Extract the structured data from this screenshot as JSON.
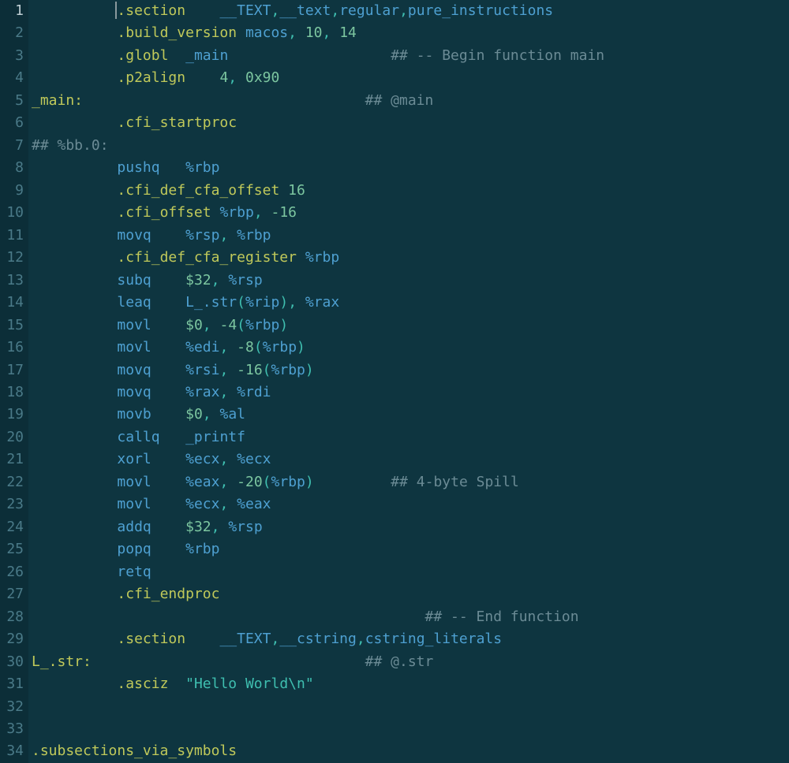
{
  "lines": [
    {
      "n": 1,
      "current": true,
      "tokens": [
        {
          "t": "    ",
          "c": "tok-plain"
        },
        {
          "t": "|",
          "c": "cursor"
        },
        {
          "t": ".section",
          "c": "tok-dir"
        },
        {
          "t": "    ",
          "c": "tok-plain"
        },
        {
          "t": "__TEXT",
          "c": "tok-id"
        },
        {
          "t": ",",
          "c": "tok-punct"
        },
        {
          "t": "__text",
          "c": "tok-id"
        },
        {
          "t": ",",
          "c": "tok-punct"
        },
        {
          "t": "regular",
          "c": "tok-id"
        },
        {
          "t": ",",
          "c": "tok-punct"
        },
        {
          "t": "pure_instructions",
          "c": "tok-id"
        }
      ]
    },
    {
      "n": 2,
      "tokens": [
        {
          "t": "    ",
          "c": "tok-plain"
        },
        {
          "t": ".build_version",
          "c": "tok-dir"
        },
        {
          "t": " ",
          "c": "tok-plain"
        },
        {
          "t": "macos",
          "c": "tok-id"
        },
        {
          "t": ", ",
          "c": "tok-punct"
        },
        {
          "t": "10",
          "c": "tok-num"
        },
        {
          "t": ", ",
          "c": "tok-punct"
        },
        {
          "t": "14",
          "c": "tok-num"
        }
      ]
    },
    {
      "n": 3,
      "tokens": [
        {
          "t": "    ",
          "c": "tok-plain"
        },
        {
          "t": ".globl",
          "c": "tok-dir"
        },
        {
          "t": "  ",
          "c": "tok-plain"
        },
        {
          "t": "_main",
          "c": "tok-id"
        },
        {
          "t": "                   ",
          "c": "tok-plain"
        },
        {
          "t": "## -- Begin function main",
          "c": "tok-cmt"
        }
      ]
    },
    {
      "n": 4,
      "tokens": [
        {
          "t": "    ",
          "c": "tok-plain"
        },
        {
          "t": ".p2align",
          "c": "tok-dir"
        },
        {
          "t": "    ",
          "c": "tok-plain"
        },
        {
          "t": "4",
          "c": "tok-num"
        },
        {
          "t": ", ",
          "c": "tok-punct"
        },
        {
          "t": "0x90",
          "c": "tok-num"
        }
      ]
    },
    {
      "n": 5,
      "tokens": [
        {
          "t": "_main:",
          "c": "tok-label"
        },
        {
          "t": "                                 ",
          "c": "tok-plain"
        },
        {
          "t": "## @main",
          "c": "tok-cmt"
        }
      ]
    },
    {
      "n": 6,
      "tokens": [
        {
          "t": "    ",
          "c": "tok-plain"
        },
        {
          "t": ".cfi_startproc",
          "c": "tok-dir"
        }
      ]
    },
    {
      "n": 7,
      "tokens": [
        {
          "t": "## %bb.0:",
          "c": "tok-cmt"
        }
      ]
    },
    {
      "n": 8,
      "tokens": [
        {
          "t": "    ",
          "c": "tok-plain"
        },
        {
          "t": "pushq",
          "c": "tok-mnem"
        },
        {
          "t": "   ",
          "c": "tok-plain"
        },
        {
          "t": "%rbp",
          "c": "tok-reg"
        }
      ]
    },
    {
      "n": 9,
      "tokens": [
        {
          "t": "    ",
          "c": "tok-plain"
        },
        {
          "t": ".cfi_def_cfa_offset",
          "c": "tok-dir"
        },
        {
          "t": " ",
          "c": "tok-plain"
        },
        {
          "t": "16",
          "c": "tok-num"
        }
      ]
    },
    {
      "n": 10,
      "tokens": [
        {
          "t": "    ",
          "c": "tok-plain"
        },
        {
          "t": ".cfi_offset",
          "c": "tok-dir"
        },
        {
          "t": " ",
          "c": "tok-plain"
        },
        {
          "t": "%rbp",
          "c": "tok-reg"
        },
        {
          "t": ", ",
          "c": "tok-punct"
        },
        {
          "t": "-16",
          "c": "tok-num"
        }
      ]
    },
    {
      "n": 11,
      "tokens": [
        {
          "t": "    ",
          "c": "tok-plain"
        },
        {
          "t": "movq",
          "c": "tok-mnem"
        },
        {
          "t": "    ",
          "c": "tok-plain"
        },
        {
          "t": "%rsp",
          "c": "tok-reg"
        },
        {
          "t": ", ",
          "c": "tok-punct"
        },
        {
          "t": "%rbp",
          "c": "tok-reg"
        }
      ]
    },
    {
      "n": 12,
      "tokens": [
        {
          "t": "    ",
          "c": "tok-plain"
        },
        {
          "t": ".cfi_def_cfa_register",
          "c": "tok-dir"
        },
        {
          "t": " ",
          "c": "tok-plain"
        },
        {
          "t": "%rbp",
          "c": "tok-reg"
        }
      ]
    },
    {
      "n": 13,
      "tokens": [
        {
          "t": "    ",
          "c": "tok-plain"
        },
        {
          "t": "subq",
          "c": "tok-mnem"
        },
        {
          "t": "    ",
          "c": "tok-plain"
        },
        {
          "t": "$32",
          "c": "tok-num"
        },
        {
          "t": ", ",
          "c": "tok-punct"
        },
        {
          "t": "%rsp",
          "c": "tok-reg"
        }
      ]
    },
    {
      "n": 14,
      "tokens": [
        {
          "t": "    ",
          "c": "tok-plain"
        },
        {
          "t": "leaq",
          "c": "tok-mnem"
        },
        {
          "t": "    ",
          "c": "tok-plain"
        },
        {
          "t": "L_.str",
          "c": "tok-id"
        },
        {
          "t": "(",
          "c": "tok-punct"
        },
        {
          "t": "%rip",
          "c": "tok-reg"
        },
        {
          "t": ")",
          "c": "tok-punct"
        },
        {
          "t": ", ",
          "c": "tok-punct"
        },
        {
          "t": "%rax",
          "c": "tok-reg"
        }
      ]
    },
    {
      "n": 15,
      "tokens": [
        {
          "t": "    ",
          "c": "tok-plain"
        },
        {
          "t": "movl",
          "c": "tok-mnem"
        },
        {
          "t": "    ",
          "c": "tok-plain"
        },
        {
          "t": "$0",
          "c": "tok-num"
        },
        {
          "t": ", ",
          "c": "tok-punct"
        },
        {
          "t": "-4",
          "c": "tok-num"
        },
        {
          "t": "(",
          "c": "tok-punct"
        },
        {
          "t": "%rbp",
          "c": "tok-reg"
        },
        {
          "t": ")",
          "c": "tok-punct"
        }
      ]
    },
    {
      "n": 16,
      "tokens": [
        {
          "t": "    ",
          "c": "tok-plain"
        },
        {
          "t": "movl",
          "c": "tok-mnem"
        },
        {
          "t": "    ",
          "c": "tok-plain"
        },
        {
          "t": "%edi",
          "c": "tok-reg"
        },
        {
          "t": ", ",
          "c": "tok-punct"
        },
        {
          "t": "-8",
          "c": "tok-num"
        },
        {
          "t": "(",
          "c": "tok-punct"
        },
        {
          "t": "%rbp",
          "c": "tok-reg"
        },
        {
          "t": ")",
          "c": "tok-punct"
        }
      ]
    },
    {
      "n": 17,
      "tokens": [
        {
          "t": "    ",
          "c": "tok-plain"
        },
        {
          "t": "movq",
          "c": "tok-mnem"
        },
        {
          "t": "    ",
          "c": "tok-plain"
        },
        {
          "t": "%rsi",
          "c": "tok-reg"
        },
        {
          "t": ", ",
          "c": "tok-punct"
        },
        {
          "t": "-16",
          "c": "tok-num"
        },
        {
          "t": "(",
          "c": "tok-punct"
        },
        {
          "t": "%rbp",
          "c": "tok-reg"
        },
        {
          "t": ")",
          "c": "tok-punct"
        }
      ]
    },
    {
      "n": 18,
      "tokens": [
        {
          "t": "    ",
          "c": "tok-plain"
        },
        {
          "t": "movq",
          "c": "tok-mnem"
        },
        {
          "t": "    ",
          "c": "tok-plain"
        },
        {
          "t": "%rax",
          "c": "tok-reg"
        },
        {
          "t": ", ",
          "c": "tok-punct"
        },
        {
          "t": "%rdi",
          "c": "tok-reg"
        }
      ]
    },
    {
      "n": 19,
      "tokens": [
        {
          "t": "    ",
          "c": "tok-plain"
        },
        {
          "t": "movb",
          "c": "tok-mnem"
        },
        {
          "t": "    ",
          "c": "tok-plain"
        },
        {
          "t": "$0",
          "c": "tok-num"
        },
        {
          "t": ", ",
          "c": "tok-punct"
        },
        {
          "t": "%al",
          "c": "tok-reg"
        }
      ]
    },
    {
      "n": 20,
      "tokens": [
        {
          "t": "    ",
          "c": "tok-plain"
        },
        {
          "t": "callq",
          "c": "tok-mnem"
        },
        {
          "t": "   ",
          "c": "tok-plain"
        },
        {
          "t": "_printf",
          "c": "tok-id"
        }
      ]
    },
    {
      "n": 21,
      "tokens": [
        {
          "t": "    ",
          "c": "tok-plain"
        },
        {
          "t": "xorl",
          "c": "tok-mnem"
        },
        {
          "t": "    ",
          "c": "tok-plain"
        },
        {
          "t": "%ecx",
          "c": "tok-reg"
        },
        {
          "t": ", ",
          "c": "tok-punct"
        },
        {
          "t": "%ecx",
          "c": "tok-reg"
        }
      ]
    },
    {
      "n": 22,
      "tokens": [
        {
          "t": "    ",
          "c": "tok-plain"
        },
        {
          "t": "movl",
          "c": "tok-mnem"
        },
        {
          "t": "    ",
          "c": "tok-plain"
        },
        {
          "t": "%eax",
          "c": "tok-reg"
        },
        {
          "t": ", ",
          "c": "tok-punct"
        },
        {
          "t": "-20",
          "c": "tok-num"
        },
        {
          "t": "(",
          "c": "tok-punct"
        },
        {
          "t": "%rbp",
          "c": "tok-reg"
        },
        {
          "t": ")",
          "c": "tok-punct"
        },
        {
          "t": "         ",
          "c": "tok-plain"
        },
        {
          "t": "## 4-byte Spill",
          "c": "tok-cmt"
        }
      ]
    },
    {
      "n": 23,
      "tokens": [
        {
          "t": "    ",
          "c": "tok-plain"
        },
        {
          "t": "movl",
          "c": "tok-mnem"
        },
        {
          "t": "    ",
          "c": "tok-plain"
        },
        {
          "t": "%ecx",
          "c": "tok-reg"
        },
        {
          "t": ", ",
          "c": "tok-punct"
        },
        {
          "t": "%eax",
          "c": "tok-reg"
        }
      ]
    },
    {
      "n": 24,
      "tokens": [
        {
          "t": "    ",
          "c": "tok-plain"
        },
        {
          "t": "addq",
          "c": "tok-mnem"
        },
        {
          "t": "    ",
          "c": "tok-plain"
        },
        {
          "t": "$32",
          "c": "tok-num"
        },
        {
          "t": ", ",
          "c": "tok-punct"
        },
        {
          "t": "%rsp",
          "c": "tok-reg"
        }
      ]
    },
    {
      "n": 25,
      "tokens": [
        {
          "t": "    ",
          "c": "tok-plain"
        },
        {
          "t": "popq",
          "c": "tok-mnem"
        },
        {
          "t": "    ",
          "c": "tok-plain"
        },
        {
          "t": "%rbp",
          "c": "tok-reg"
        }
      ]
    },
    {
      "n": 26,
      "tokens": [
        {
          "t": "    ",
          "c": "tok-plain"
        },
        {
          "t": "retq",
          "c": "tok-mnem"
        }
      ]
    },
    {
      "n": 27,
      "tokens": [
        {
          "t": "    ",
          "c": "tok-plain"
        },
        {
          "t": ".cfi_endproc",
          "c": "tok-dir"
        }
      ]
    },
    {
      "n": 28,
      "tokens": [
        {
          "t": "                                        ",
          "c": "tok-plain"
        },
        {
          "t": "## -- End function",
          "c": "tok-cmt"
        }
      ]
    },
    {
      "n": 29,
      "tokens": [
        {
          "t": "    ",
          "c": "tok-plain"
        },
        {
          "t": ".section",
          "c": "tok-dir"
        },
        {
          "t": "    ",
          "c": "tok-plain"
        },
        {
          "t": "__TEXT",
          "c": "tok-id"
        },
        {
          "t": ",",
          "c": "tok-punct"
        },
        {
          "t": "__cstring",
          "c": "tok-id"
        },
        {
          "t": ",",
          "c": "tok-punct"
        },
        {
          "t": "cstring_literals",
          "c": "tok-id"
        }
      ]
    },
    {
      "n": 30,
      "tokens": [
        {
          "t": "L_.str:",
          "c": "tok-label"
        },
        {
          "t": "                                ",
          "c": "tok-plain"
        },
        {
          "t": "## @.str",
          "c": "tok-cmt"
        }
      ]
    },
    {
      "n": 31,
      "tokens": [
        {
          "t": "    ",
          "c": "tok-plain"
        },
        {
          "t": ".asciz",
          "c": "tok-dir"
        },
        {
          "t": "  ",
          "c": "tok-plain"
        },
        {
          "t": "\"Hello World\\n\"",
          "c": "tok-str"
        }
      ]
    },
    {
      "n": 32,
      "tokens": []
    },
    {
      "n": 33,
      "tokens": []
    },
    {
      "n": 34,
      "tokens": [
        {
          "t": ".subsections_via_symbols",
          "c": "tok-dir"
        }
      ]
    }
  ]
}
